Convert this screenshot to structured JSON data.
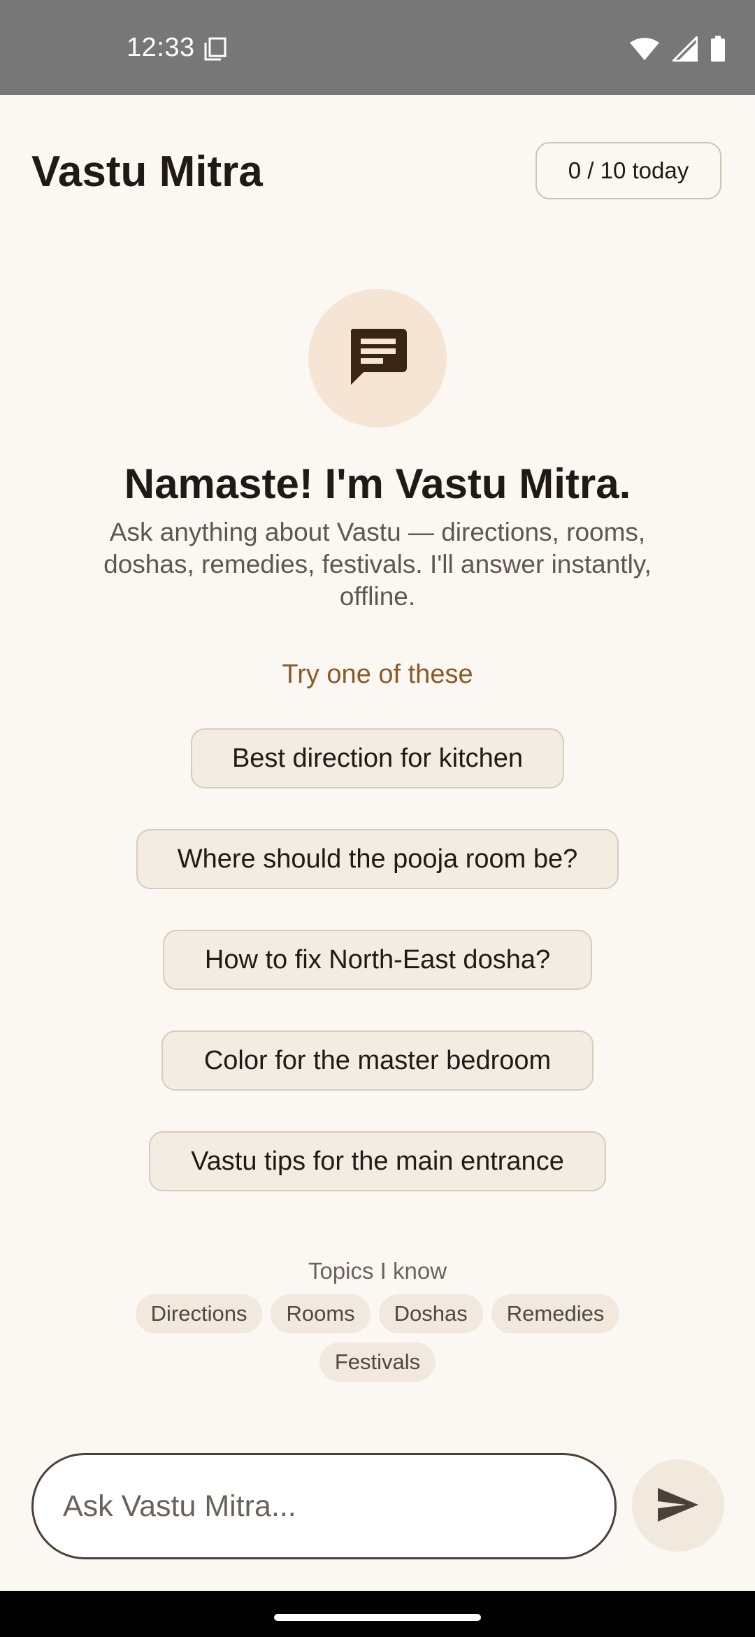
{
  "status_bar": {
    "time": "12:33",
    "icons": [
      "copy-icon",
      "wifi-icon",
      "signal-icon",
      "battery-icon"
    ]
  },
  "header": {
    "title": "Vastu Mitra",
    "quota": "0 / 10 today"
  },
  "hero": {
    "icon": "chat-bubble-icon",
    "title": "Namaste! I'm Vastu Mitra.",
    "subtitle": "Ask anything about Vastu — directions, rooms, doshas, remedies, festivals. I'll answer instantly, offline."
  },
  "suggestions": {
    "label": "Try one of these",
    "items": [
      "Best direction for kitchen",
      "Where should the pooja room be?",
      "How to fix North-East dosha?",
      "Color for the master bedroom",
      "Vastu tips for the main entrance"
    ]
  },
  "topics": {
    "label": "Topics I know",
    "items": [
      "Directions",
      "Rooms",
      "Doshas",
      "Remedies",
      "Festivals"
    ]
  },
  "composer": {
    "placeholder": "Ask Vastu Mitra...",
    "value": "",
    "send_icon": "send-icon"
  },
  "colors": {
    "background": "#FBF8F3",
    "status_bar": "#777777",
    "accent_text": "#8A5A28",
    "avatar_bg": "#F6E5D4",
    "icon_dark": "#3A2512",
    "chip_bg": "#F1E9DD"
  }
}
